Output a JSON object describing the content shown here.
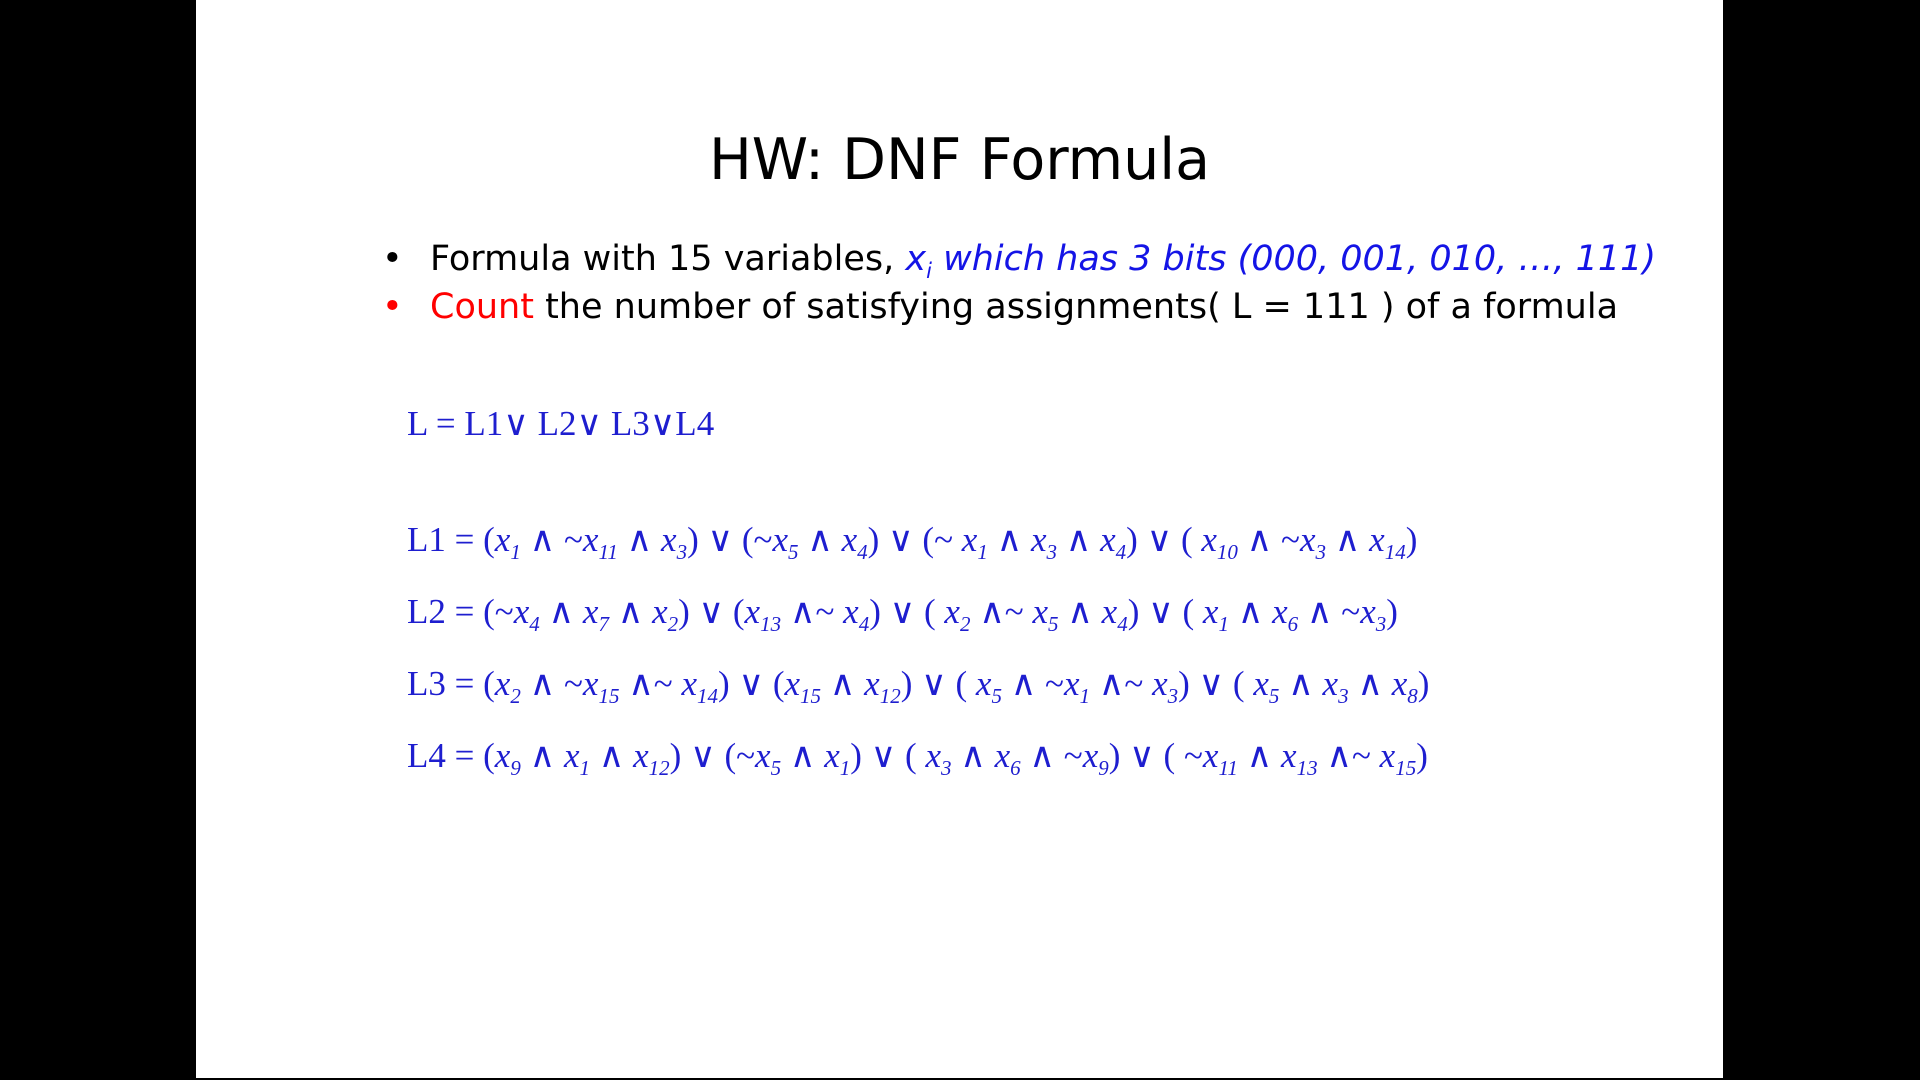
{
  "slide": {
    "title": "HW: DNF Formula",
    "bullets": [
      {
        "marker": "•",
        "text": "Formula with 15 variables, ",
        "var": "x",
        "var_sub": "i",
        "rest": " which has 3 bits (000, 001, 010, …, 111)"
      },
      {
        "marker": "•",
        "emph": "Count",
        "text": " the number of satisfying assignments( L = 111 ) of a formula"
      }
    ],
    "main_formula": "L = L1∨ L2∨ L3∨L4",
    "clause_formulas": [
      {
        "label": "L1 = ",
        "tokens": [
          {
            "t": "("
          },
          {
            "v": "x",
            "s": "1"
          },
          {
            "t": " ∧ ~"
          },
          {
            "v": "x",
            "s": "11"
          },
          {
            "t": " ∧ "
          },
          {
            "v": "x",
            "s": "3"
          },
          {
            "t": ") ∨ (~"
          },
          {
            "v": "x",
            "s": "5"
          },
          {
            "t": " ∧ "
          },
          {
            "v": "x",
            "s": "4"
          },
          {
            "t": ") ∨ (~ "
          },
          {
            "v": "x",
            "s": "1"
          },
          {
            "t": " ∧ "
          },
          {
            "v": "x",
            "s": "3"
          },
          {
            "t": " ∧ "
          },
          {
            "v": "x",
            "s": "4"
          },
          {
            "t": ") ∨ ( "
          },
          {
            "v": "x",
            "s": "10"
          },
          {
            "t": " ∧ ~"
          },
          {
            "v": "x",
            "s": "3"
          },
          {
            "t": " ∧ "
          },
          {
            "v": "x",
            "s": "14"
          },
          {
            "t": ")"
          }
        ]
      },
      {
        "label": "L2 = ",
        "tokens": [
          {
            "t": "(~"
          },
          {
            "v": "x",
            "s": "4"
          },
          {
            "t": " ∧ "
          },
          {
            "v": "x",
            "s": "7"
          },
          {
            "t": " ∧ "
          },
          {
            "v": "x",
            "s": "2"
          },
          {
            "t": ") ∨ ("
          },
          {
            "v": "x",
            "s": "13"
          },
          {
            "t": " ∧~ "
          },
          {
            "v": "x",
            "s": "4"
          },
          {
            "t": ") ∨ ( "
          },
          {
            "v": "x",
            "s": "2"
          },
          {
            "t": " ∧~ "
          },
          {
            "v": "x",
            "s": "5"
          },
          {
            "t": " ∧ "
          },
          {
            "v": "x",
            "s": "4"
          },
          {
            "t": ") ∨ ( "
          },
          {
            "v": "x",
            "s": "1"
          },
          {
            "t": " ∧ "
          },
          {
            "v": "x",
            "s": "6"
          },
          {
            "t": " ∧ ~"
          },
          {
            "v": "x",
            "s": "3"
          },
          {
            "t": ")"
          }
        ]
      },
      {
        "label": "L3 = ",
        "tokens": [
          {
            "t": "("
          },
          {
            "v": "x",
            "s": "2"
          },
          {
            "t": " ∧ ~"
          },
          {
            "v": "x",
            "s": "15"
          },
          {
            "t": " ∧~ "
          },
          {
            "v": "x",
            "s": "14"
          },
          {
            "t": ") ∨ ("
          },
          {
            "v": "x",
            "s": "15"
          },
          {
            "t": " ∧ "
          },
          {
            "v": "x",
            "s": "12"
          },
          {
            "t": ") ∨ ( "
          },
          {
            "v": "x",
            "s": "5"
          },
          {
            "t": " ∧ ~"
          },
          {
            "v": "x",
            "s": "1"
          },
          {
            "t": " ∧~ "
          },
          {
            "v": "x",
            "s": "3"
          },
          {
            "t": ") ∨ ( "
          },
          {
            "v": "x",
            "s": "5"
          },
          {
            "t": " ∧ "
          },
          {
            "v": "x",
            "s": "3"
          },
          {
            "t": " ∧ "
          },
          {
            "v": "x",
            "s": "8"
          },
          {
            "t": ")"
          }
        ]
      },
      {
        "label": "L4 = ",
        "tokens": [
          {
            "t": "("
          },
          {
            "v": "x",
            "s": "9"
          },
          {
            "t": " ∧ "
          },
          {
            "v": "x",
            "s": "1"
          },
          {
            "t": " ∧ "
          },
          {
            "v": "x",
            "s": "12"
          },
          {
            "t": ") ∨ (~"
          },
          {
            "v": "x",
            "s": "5"
          },
          {
            "t": " ∧ "
          },
          {
            "v": "x",
            "s": "1"
          },
          {
            "t": ") ∨ ( "
          },
          {
            "v": "x",
            "s": "3"
          },
          {
            "t": " ∧ "
          },
          {
            "v": "x",
            "s": "6"
          },
          {
            "t": " ∧ ~"
          },
          {
            "v": "x",
            "s": "9"
          },
          {
            "t": ") ∨ ( ~"
          },
          {
            "v": "x",
            "s": "11"
          },
          {
            "t": " ∧ "
          },
          {
            "v": "x",
            "s": "13"
          },
          {
            "t": " ∧~ "
          },
          {
            "v": "x",
            "s": "15"
          },
          {
            "t": ")"
          }
        ]
      }
    ],
    "colors": {
      "background": "#ffffff",
      "letterbox": "#000000",
      "accent_red": "#ff0000",
      "formula_blue": "#1e1ecf"
    }
  }
}
